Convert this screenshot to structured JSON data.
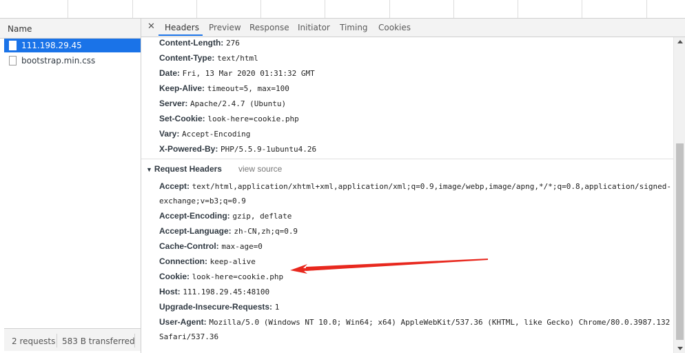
{
  "sidebar": {
    "column_header": "Name",
    "requests": [
      {
        "name": "111.198.29.45",
        "selected": true
      },
      {
        "name": "bootstrap.min.css",
        "selected": false
      }
    ],
    "footer": {
      "requests": "2 requests",
      "transferred": "583 B transferred"
    }
  },
  "tabs": [
    "Headers",
    "Preview",
    "Response",
    "Initiator",
    "Timing",
    "Cookies"
  ],
  "active_tab": "Headers",
  "response_headers": [
    {
      "key": "Content-Length:",
      "value": "276"
    },
    {
      "key": "Content-Type:",
      "value": "text/html"
    },
    {
      "key": "Date:",
      "value": "Fri, 13 Mar 2020 01:31:32 GMT"
    },
    {
      "key": "Keep-Alive:",
      "value": "timeout=5, max=100"
    },
    {
      "key": "Server:",
      "value": "Apache/2.4.7 (Ubuntu)"
    },
    {
      "key": "Set-Cookie:",
      "value": "look-here=cookie.php"
    },
    {
      "key": "Vary:",
      "value": "Accept-Encoding"
    },
    {
      "key": "X-Powered-By:",
      "value": "PHP/5.5.9-1ubuntu4.26"
    }
  ],
  "request_section": {
    "title": "Request Headers",
    "view_source": "view source"
  },
  "request_headers": [
    {
      "key": "Accept:",
      "value": "text/html,application/xhtml+xml,application/xml;q=0.9,image/webp,image/apng,*/*;q=0.8,application/signed-",
      "cont": "exchange;v=b3;q=0.9"
    },
    {
      "key": "Accept-Encoding:",
      "value": "gzip, deflate"
    },
    {
      "key": "Accept-Language:",
      "value": "zh-CN,zh;q=0.9"
    },
    {
      "key": "Cache-Control:",
      "value": "max-age=0"
    },
    {
      "key": "Connection:",
      "value": "keep-alive"
    },
    {
      "key": "Cookie:",
      "value": "look-here=cookie.php"
    },
    {
      "key": "Host:",
      "value": "111.198.29.45:48100"
    },
    {
      "key": "Upgrade-Insecure-Requests:",
      "value": "1"
    },
    {
      "key": "User-Agent:",
      "value": "Mozilla/5.0 (Windows NT 10.0; Win64; x64) AppleWebKit/537.36 (KHTML, like Gecko) Chrome/80.0.3987.132",
      "cont": "Safari/537.36"
    }
  ],
  "colors": {
    "accent": "#1a73e8",
    "annotation_arrow": "#e8281e"
  }
}
